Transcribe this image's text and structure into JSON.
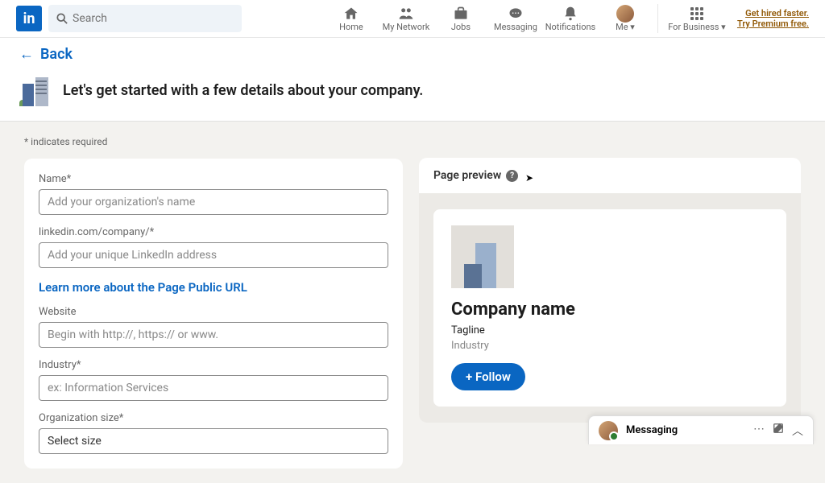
{
  "nav": {
    "searchPlaceholder": "Search",
    "home": "Home",
    "network": "My Network",
    "jobs": "Jobs",
    "messaging": "Messaging",
    "notifications": "Notifications",
    "me": "Me",
    "business": "For Business",
    "premium1": "Get hired faster.",
    "premium2": "Try Premium free."
  },
  "header": {
    "back": "Back",
    "title": "Let's get started with a few details about your company."
  },
  "requiredNote": "*  indicates required",
  "form": {
    "name": {
      "label": "Name*",
      "placeholder": "Add your organization's name"
    },
    "url": {
      "label": "linkedin.com/company/*",
      "placeholder": "Add your unique LinkedIn address"
    },
    "urlLink": "Learn more about the Page Public URL",
    "website": {
      "label": "Website",
      "placeholder": "Begin with http://, https:// or www."
    },
    "industry": {
      "label": "Industry*",
      "placeholder": "ex: Information Services"
    },
    "size": {
      "label": "Organization size*",
      "placeholder": "Select size"
    }
  },
  "preview": {
    "title": "Page preview",
    "companyName": "Company name",
    "tagline": "Tagline",
    "industry": "Industry",
    "follow": "+ Follow"
  },
  "messagingBar": {
    "title": "Messaging"
  }
}
